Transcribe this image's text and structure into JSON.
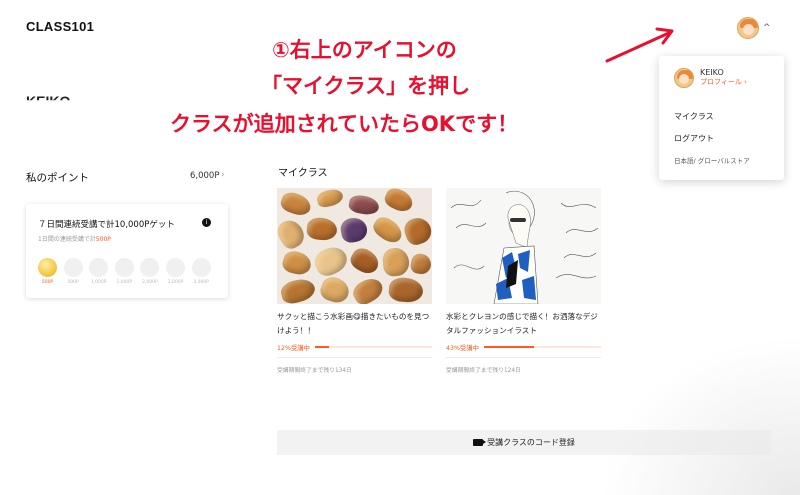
{
  "header": {
    "logo": "CLASS101",
    "avatar_caret": "^"
  },
  "profile_name_partial": "KEIKO",
  "annotation": {
    "line1": "①右上のアイコンの",
    "line2": "「マイクラス」を押し",
    "line3": "クラスが追加されていたらOKです！",
    "color": "#e8102f"
  },
  "dropdown": {
    "name": "KEIKO",
    "profile_link": "プロフィール ›",
    "items": [
      "マイクラス",
      "ログアウト",
      "日本語/ グローバルストア"
    ]
  },
  "points": {
    "title": "私のポイント",
    "value": "6,000P",
    "chevron": "›",
    "card_title": "７日間連続受講で計10,000Pゲット",
    "card_info_icon": "i",
    "card_sub_prefix": "1日間の連続受講で計",
    "card_sub_highlight": "500P",
    "days": [
      "500P",
      "500P",
      "1,000P",
      "1,000P",
      "2,000P",
      "2,000P",
      "3,000P"
    ],
    "active_day_count": 1
  },
  "my_class": {
    "title": "マイクラス",
    "classes": [
      {
        "name": "サクッと描こう水彩画😋描きたいものを見つけよう！！",
        "progress_label": "12%受講中",
        "progress": 12,
        "remaining": "受講期間終了まで残り134日"
      },
      {
        "name": "水彩とクレヨンの感じで描く！お洒落なデジタルファッションイラスト",
        "progress_label": "43%受講中",
        "progress": 43,
        "remaining": "受講期間終了まで残り124日"
      }
    ]
  },
  "code_button": {
    "label": "受講クラスのコード登録",
    "icon": "camera-icon"
  },
  "colors": {
    "accent": "#ff5a1f"
  }
}
